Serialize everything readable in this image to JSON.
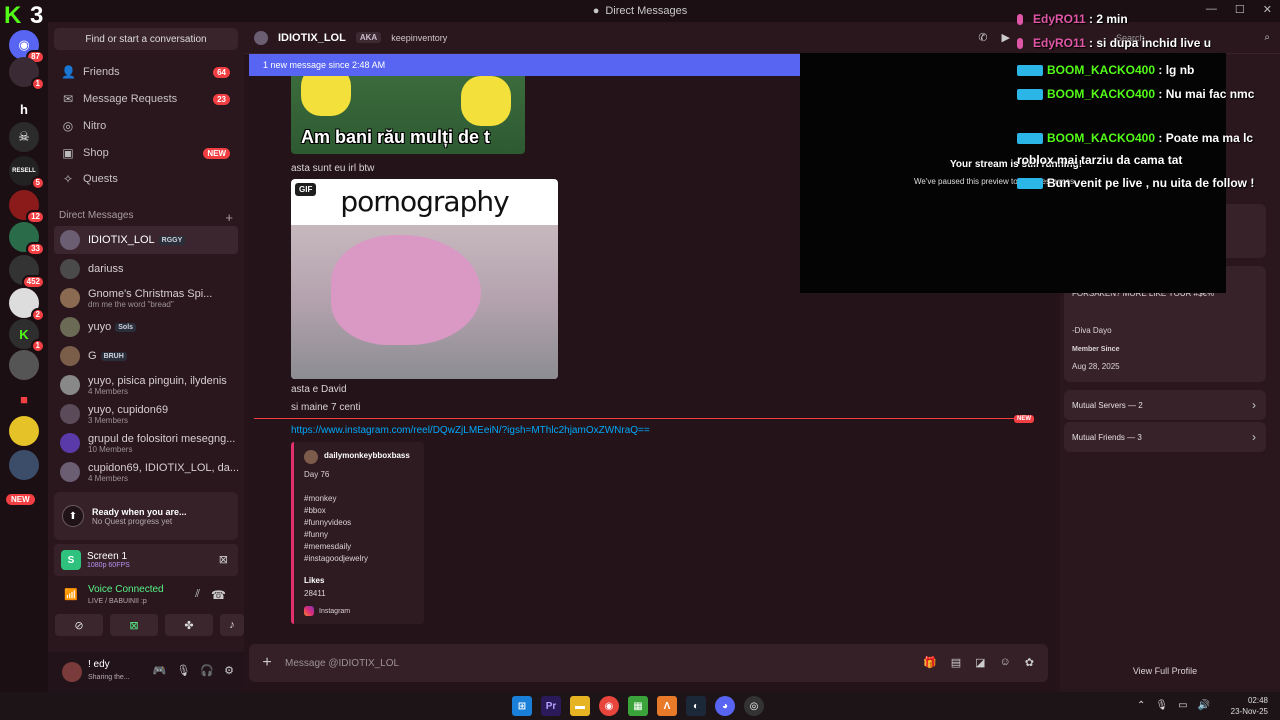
{
  "titlebar": {
    "title": "Direct Messages",
    "minimize": "—",
    "maximize": "☐",
    "close": "✕"
  },
  "rail": {
    "logo_k": "K",
    "logo_3": "3",
    "servers": [
      {
        "name": "home",
        "badge": "87"
      },
      {
        "name": "server-2",
        "badge": "1"
      },
      {
        "name": "server-3",
        "badge": ""
      },
      {
        "name": "server-4",
        "badge": ""
      },
      {
        "name": "server-5",
        "badge": "5"
      },
      {
        "name": "server-6",
        "badge": "12"
      },
      {
        "name": "server-7",
        "badge": "33"
      },
      {
        "name": "server-8",
        "badge": "452"
      },
      {
        "name": "server-9",
        "badge": "2"
      },
      {
        "name": "server-10",
        "badge": "1"
      },
      {
        "name": "server-11",
        "badge": ""
      }
    ],
    "new_label": "NEW"
  },
  "sidebar": {
    "search_placeholder": "Find or start a conversation",
    "nav": [
      {
        "label": "Friends",
        "icon": "friends-icon",
        "badge": "64"
      },
      {
        "label": "Message Requests",
        "icon": "envelope-icon",
        "badge": "23"
      },
      {
        "label": "Nitro",
        "icon": "nitro-icon",
        "badge": ""
      },
      {
        "label": "Shop",
        "icon": "shop-icon",
        "badge": "NEW"
      },
      {
        "label": "Quests",
        "icon": "quests-icon",
        "badge": ""
      }
    ],
    "dm_header": "Direct Messages",
    "dm_add": "+",
    "dms": [
      {
        "name": "IDIOTIX_LOL",
        "tag": "RGGY",
        "sub": "",
        "active": true
      },
      {
        "name": "dariuss",
        "tag": "",
        "sub": ""
      },
      {
        "name": "Gnome's Christmas Spi...",
        "tag": "",
        "sub": "dm me the word \"bread\""
      },
      {
        "name": "yuyo",
        "tag": "Sols",
        "sub": ""
      },
      {
        "name": "G",
        "tag": "BRUH",
        "sub": ""
      },
      {
        "name": "yuyo, pisica pinguin, ilydenis",
        "tag": "",
        "sub": "4 Members"
      },
      {
        "name": "yuyo, cupidon69",
        "tag": "",
        "sub": "3 Members"
      },
      {
        "name": "grupul de folositori mesegng...",
        "tag": "",
        "sub": "10 Members"
      },
      {
        "name": "cupidon69, IDIOTIX_LOL, da...",
        "tag": "",
        "sub": "4 Members"
      }
    ],
    "quest": {
      "title": "Ready when you are...",
      "sub": "No Quest progress yet"
    },
    "screen": {
      "title": "Screen 1",
      "sub": "1080p 60FPS"
    },
    "voice": {
      "title": "Voice Connected",
      "sub": "LIVE / BABUINII :p"
    },
    "user": {
      "name": "! edy",
      "status": "Sharing the..."
    }
  },
  "chat": {
    "title": "IDIOTIX_LOL",
    "aka": "AKA",
    "aka_names": "keepinventory",
    "search_placeholder": "Search",
    "new_since": "1 new message since 2:48 AM",
    "meme_caption": "Am bani rău mulți de t",
    "msg1": "asta sunt eu irl btw",
    "gif_badge": "GIF",
    "gif_title": "pornography",
    "msg2": "asta e David",
    "msg3": "si maine 7 centi",
    "new_tag": "NEW",
    "link": "https://www.instagram.com/reel/DQwZjLMEeiN/?igsh=MThlc2hjamOxZWNraQ==",
    "embed": {
      "author": "dailymonkeybboxbass",
      "lines": [
        "Day 76",
        "",
        "#monkey",
        "#bbox",
        "#funnyvideos",
        "#funny",
        "#memesdaily",
        "#instagoodjewelry"
      ],
      "likes_label": "Likes",
      "likes": "28411",
      "footer": "Instagram"
    },
    "composer_placeholder": "Message @IDIOTIX_LOL"
  },
  "stream": {
    "title": "Your stream is still running!",
    "sub": "We've paused this preview to save resources."
  },
  "profile": {
    "quote": "FORSAKEN? MORE LIKE YOUR #$€%",
    "author": "-Diva Dayo",
    "member_since_label": "Member Since",
    "member_since": "Aug 28, 2025",
    "mutual_servers": "Mutual Servers — 2",
    "mutual_friends": "Mutual Friends — 3",
    "view_full": "View Full Profile"
  },
  "overlay": [
    {
      "user": "EdyRO11",
      "text": ": 2 min",
      "color": "pink"
    },
    {
      "user": "EdyRO11",
      "text": ": si dupa inchid live u",
      "color": "pink"
    },
    {
      "user": "BOOM_KACKO400",
      "text": ": lg nb",
      "color": "green"
    },
    {
      "user": "BOOM_KACKO400",
      "text": ": Nu mai fac nmc",
      "color": "green"
    },
    {
      "user": "BOOM_KACKO400",
      "text": ": Poate ma ma lc roblox mai tarziu da cama tat",
      "color": "green"
    },
    {
      "user": "",
      "text": "Bun venit pe live , nu uita de follow !",
      "color": "white"
    }
  ],
  "taskbar": {
    "apps": [
      "windows",
      "premiere",
      "explorer",
      "chrome",
      "minecraft",
      "app-a",
      "steam",
      "discord",
      "app-b"
    ],
    "time": "02:48",
    "date": "23-Nov-25"
  }
}
